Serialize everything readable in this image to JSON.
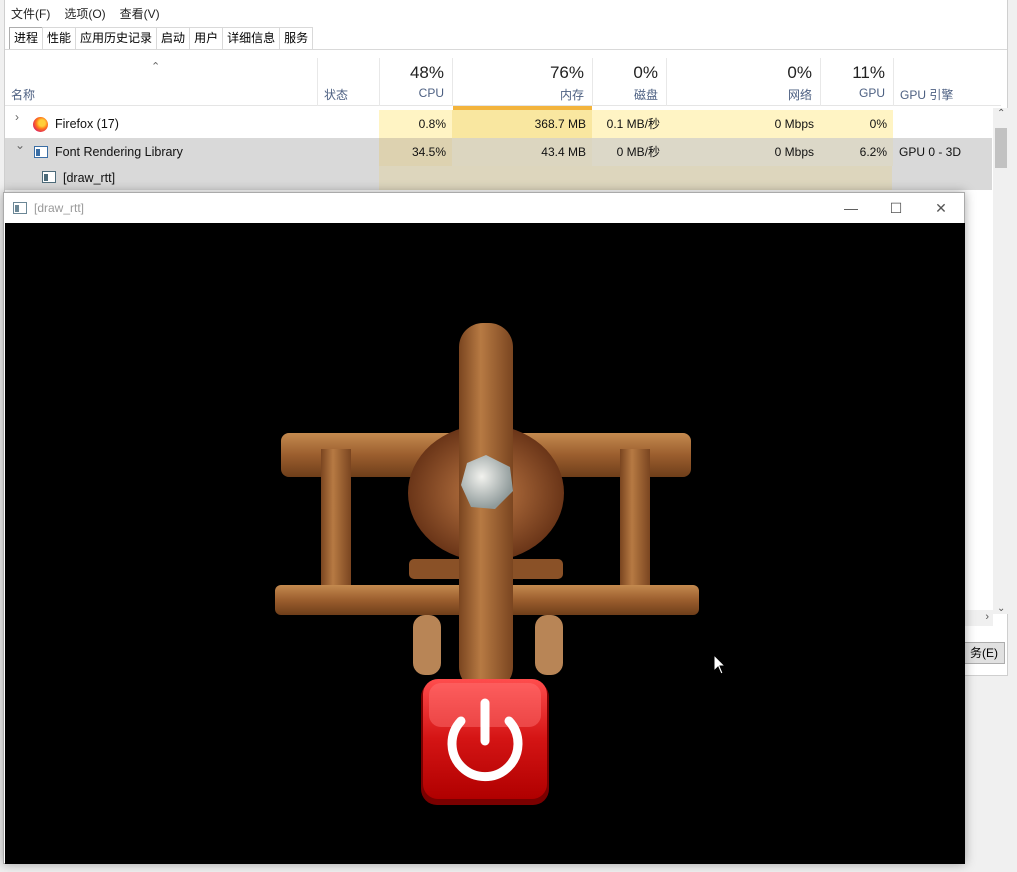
{
  "task_manager": {
    "menu": [
      "文件(F)",
      "选项(O)",
      "查看(V)"
    ],
    "tabs": [
      "进程",
      "性能",
      "应用历史记录",
      "启动",
      "用户",
      "详细信息",
      "服务"
    ],
    "columns": {
      "name": "名称",
      "status": "状态",
      "cpu": {
        "pct": "48%",
        "label": "CPU"
      },
      "memory": {
        "pct": "76%",
        "label": "内存"
      },
      "disk": {
        "pct": "0%",
        "label": "磁盘"
      },
      "network": {
        "pct": "0%",
        "label": "网络"
      },
      "gpu": {
        "pct": "11%",
        "label": "GPU"
      },
      "gpu_engine": "GPU 引擎"
    },
    "rows": [
      {
        "name": "Firefox (17)",
        "cpu": "0.8%",
        "memory": "368.7 MB",
        "disk": "0.1 MB/秒",
        "network": "0 Mbps",
        "gpu": "0%",
        "gpu_engine": ""
      },
      {
        "name": "Font Rendering Library",
        "cpu": "34.5%",
        "memory": "43.4 MB",
        "disk": "0 MB/秒",
        "network": "0 Mbps",
        "gpu": "6.2%",
        "gpu_engine": "GPU 0 - 3D"
      },
      {
        "name": "[draw_rtt]"
      }
    ],
    "end_task_label": "务(E)",
    "colors": {
      "heat_light": "#fff4c4",
      "heat_mid": "#f9eca8",
      "selected_row": "#d9d9d9",
      "memory_accent": "#f3b43d"
    }
  },
  "game_window": {
    "title": "[draw_rtt]",
    "minimize": "—",
    "maximize": "☐",
    "close": "✕",
    "icons": {
      "window_icon": "app-window-icon",
      "power": "power-icon"
    },
    "colors": {
      "canvas_bg": "#000000",
      "button_red": "#d41414",
      "plane_wood": "#9b5e2e"
    }
  }
}
